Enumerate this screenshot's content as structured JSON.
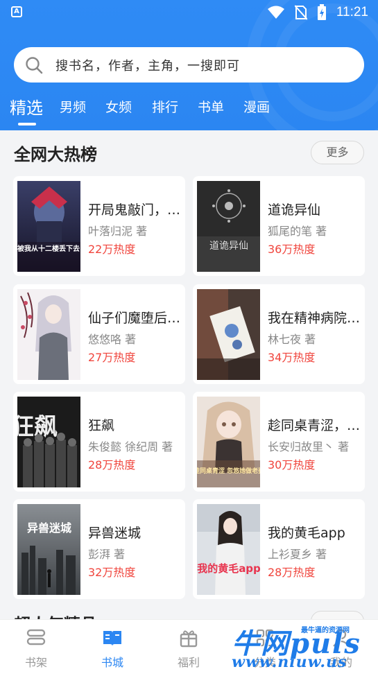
{
  "status_bar": {
    "time": "11:21",
    "app_icon_letter": "A"
  },
  "search": {
    "placeholder": "搜书名，作者，主角，一搜即可"
  },
  "tabs": [
    {
      "label": "精选",
      "active": true
    },
    {
      "label": "男频"
    },
    {
      "label": "女频"
    },
    {
      "label": "排行"
    },
    {
      "label": "书单"
    },
    {
      "label": "漫画"
    }
  ],
  "hot_section": {
    "title": "全网大热榜",
    "more_label": "更多",
    "books": [
      {
        "title": "开局鬼敲门，被我从十二楼丢下去",
        "author": "叶落归泥 著",
        "heat": "22万热度",
        "cover_text": "被我从十二楼丢下去"
      },
      {
        "title": "道诡异仙",
        "author": "狐尾的笔 著",
        "heat": "36万热度",
        "cover_text": "道诡异仙"
      },
      {
        "title": "仙子们魔堕后，悔不当初",
        "author": "悠悠咯 著",
        "heat": "27万热度"
      },
      {
        "title": "我在精神病院学斩神",
        "author": "林七夜 著",
        "heat": "34万热度"
      },
      {
        "title": "狂飙",
        "author": "朱俊懿 徐纪周 著",
        "heat": "28万热度",
        "cover_text": "狂飙"
      },
      {
        "title": "趁同桌青涩，忽悠她做老婆",
        "author": "长安归故里丶 著",
        "heat": "30万热度",
        "cover_text": "趁同桌青涩 忽悠她做老婆"
      },
      {
        "title": "异兽迷城",
        "author": "彭湃 著",
        "heat": "32万热度",
        "cover_text": "异兽迷城"
      },
      {
        "title": "我的黄毛app",
        "author": "上衫夏乡 著",
        "heat": "28万热度",
        "cover_text": "我的黄毛app"
      }
    ]
  },
  "next_section": {
    "title": "超人气精品"
  },
  "bottom_nav": [
    {
      "label": "书架",
      "icon": "bookshelf-icon"
    },
    {
      "label": "书城",
      "icon": "book-city-icon",
      "active": true
    },
    {
      "label": "福利",
      "icon": "gift-icon"
    },
    {
      "label": "分类",
      "icon": "category-icon"
    },
    {
      "label": "我的",
      "icon": "user-icon"
    }
  ],
  "watermark": {
    "brand": "牛网puls",
    "tagline": "最牛逼的资源网",
    "url": "www.niuw.us"
  },
  "colors": {
    "primary": "#2b86f2",
    "heat": "#f0443c",
    "background": "#f3f4f6"
  }
}
